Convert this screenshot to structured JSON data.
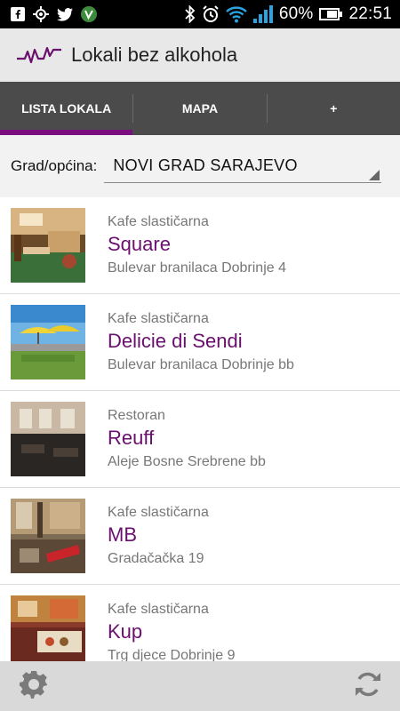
{
  "status_bar": {
    "battery_percent": "60%",
    "time": "22:51",
    "icons": [
      "notification-icon",
      "gps-icon",
      "twitter-icon",
      "vine-icon",
      "bluetooth-icon",
      "alarm-icon",
      "wifi-icon",
      "signal-icon",
      "battery-icon"
    ]
  },
  "app": {
    "title": "Lokali bez alkohola",
    "accent_color": "#7a0e7e",
    "name_color": "#6a0f6e"
  },
  "tabs": [
    {
      "label": "LISTA LOKALA",
      "active": true
    },
    {
      "label": "MAPA",
      "active": false
    },
    {
      "label": "+",
      "active": false
    }
  ],
  "filter": {
    "label": "Grad/općina:",
    "selected": "NOVI GRAD SARAJEVO"
  },
  "places": [
    {
      "category": "Kafe slastičarna",
      "name": "Square",
      "address": "Bulevar branilaca Dobrinje 4"
    },
    {
      "category": "Kafe slastičarna",
      "name": "Delicie di Sendi",
      "address": "Bulevar branilaca Dobrinje bb"
    },
    {
      "category": "Restoran",
      "name": "Reuff",
      "address": "Aleje Bosne Srebrene bb"
    },
    {
      "category": "Kafe slastičarna",
      "name": "MB",
      "address": "Gradačačka 19"
    },
    {
      "category": "Kafe slastičarna",
      "name": "Kup",
      "address": "Trg djece Dobrinje 9"
    }
  ],
  "bottom_bar": {
    "left_icon": "settings-icon",
    "right_icon": "refresh-icon"
  }
}
